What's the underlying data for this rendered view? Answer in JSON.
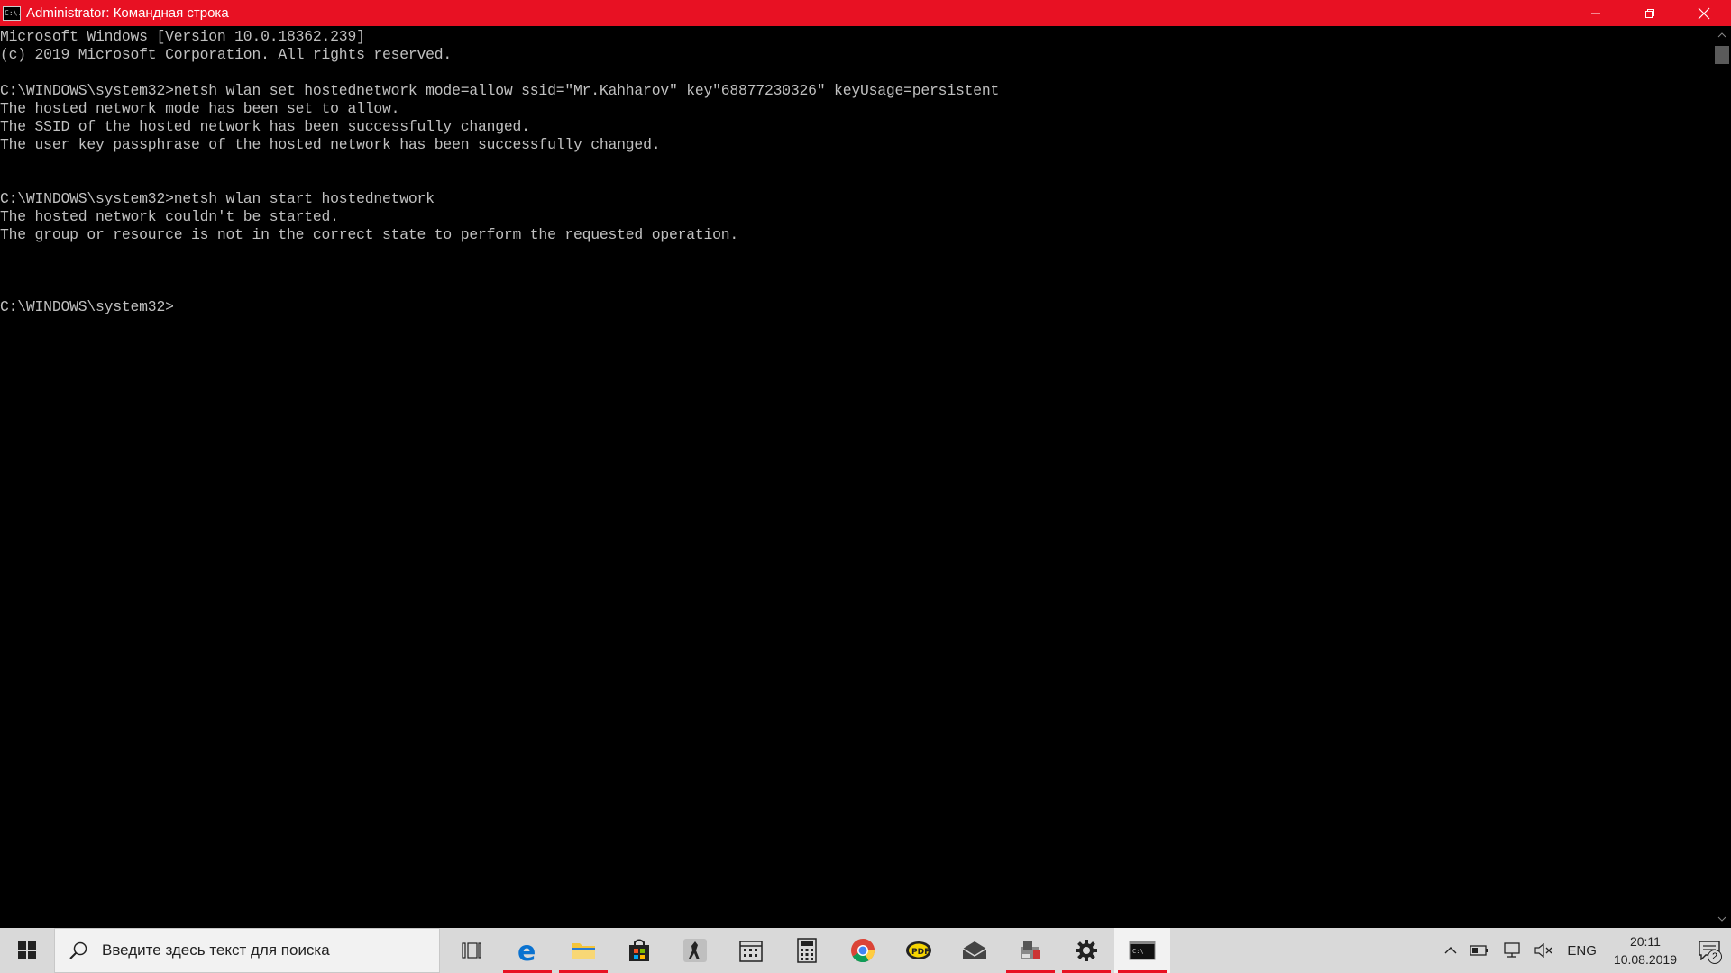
{
  "window": {
    "title": "Administrator: Командная строка",
    "icon_label": "C:\\."
  },
  "console": {
    "lines": [
      "Microsoft Windows [Version 10.0.18362.239]",
      "(c) 2019 Microsoft Corporation. All rights reserved.",
      "",
      "C:\\WINDOWS\\system32>netsh wlan set hostednetwork mode=allow ssid=\"Mr.Kahharov\" key\"68877230326\" keyUsage=persistent",
      "The hosted network mode has been set to allow.",
      "The SSID of the hosted network has been successfully changed.",
      "The user key passphrase of the hosted network has been successfully changed.",
      "",
      "",
      "C:\\WINDOWS\\system32>netsh wlan start hostednetwork",
      "The hosted network couldn't be started.",
      "The group or resource is not in the correct state to perform the requested operation.",
      "",
      "",
      "",
      "C:\\WINDOWS\\system32>"
    ]
  },
  "taskbar": {
    "search_placeholder": "Введите здесь текст для поиска",
    "apps": [
      {
        "name": "task-view-icon",
        "running": false
      },
      {
        "name": "edge-icon",
        "running": true
      },
      {
        "name": "file-explorer-icon",
        "running": true
      },
      {
        "name": "microsoft-store-icon",
        "running": false
      },
      {
        "name": "counter-strike-icon",
        "running": false
      },
      {
        "name": "calendar-icon",
        "running": false
      },
      {
        "name": "calculator-icon",
        "running": false
      },
      {
        "name": "chrome-icon",
        "running": false
      },
      {
        "name": "pdf-reader-icon",
        "running": false
      },
      {
        "name": "mail-icon",
        "running": false
      },
      {
        "name": "app-installer-icon",
        "running": true
      },
      {
        "name": "settings-icon",
        "running": true
      },
      {
        "name": "command-prompt-icon",
        "running": true,
        "active": true
      }
    ],
    "tray": {
      "language": "ENG",
      "time": "20:11",
      "date": "10.08.2019",
      "notification_count": "2"
    }
  },
  "colors": {
    "titlebar": "#e81123",
    "console_bg": "#000000",
    "console_text": "#c0c0c0",
    "taskbar_bg": "#d9d9d9"
  }
}
